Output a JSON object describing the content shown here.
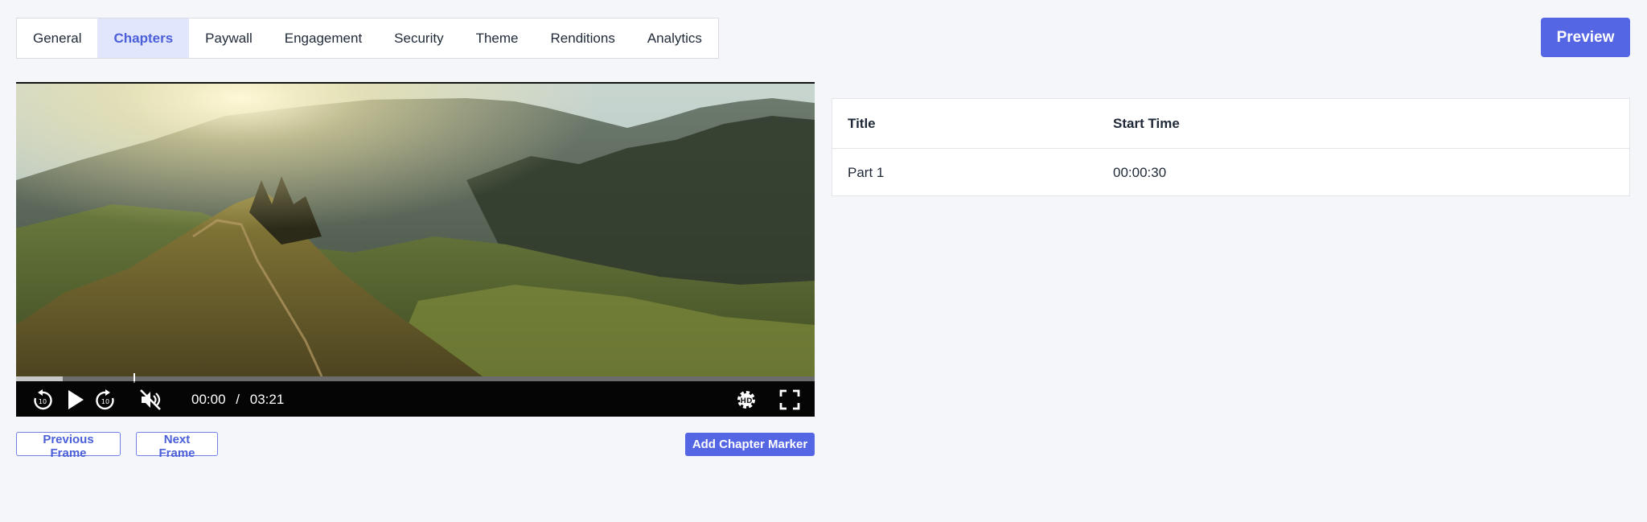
{
  "tabs": [
    {
      "label": "General",
      "active": false
    },
    {
      "label": "Chapters",
      "active": true
    },
    {
      "label": "Paywall",
      "active": false
    },
    {
      "label": "Engagement",
      "active": false
    },
    {
      "label": "Security",
      "active": false
    },
    {
      "label": "Theme",
      "active": false
    },
    {
      "label": "Renditions",
      "active": false
    },
    {
      "label": "Analytics",
      "active": false
    }
  ],
  "header": {
    "preview_label": "Preview"
  },
  "player": {
    "current_time": "00:00",
    "separator": "/",
    "duration": "03:21",
    "buffered_fraction": 0.058,
    "icons": [
      "rewind-10-icon",
      "play-icon",
      "forward-10-icon",
      "muted-icon",
      "hd-settings-icon",
      "fullscreen-icon"
    ]
  },
  "frame_controls": {
    "previous_label": "Previous Frame",
    "next_label": "Next Frame",
    "add_marker_label": "Add Chapter Marker"
  },
  "chapters_table": {
    "headers": [
      "Title",
      "Start Time"
    ],
    "rows": [
      [
        "Part 1",
        "00:00:30"
      ]
    ]
  },
  "colors": {
    "accent": "#5566e4",
    "active_tab_bg": "#e1e6fc",
    "page_bg": "#f5f6fa"
  }
}
